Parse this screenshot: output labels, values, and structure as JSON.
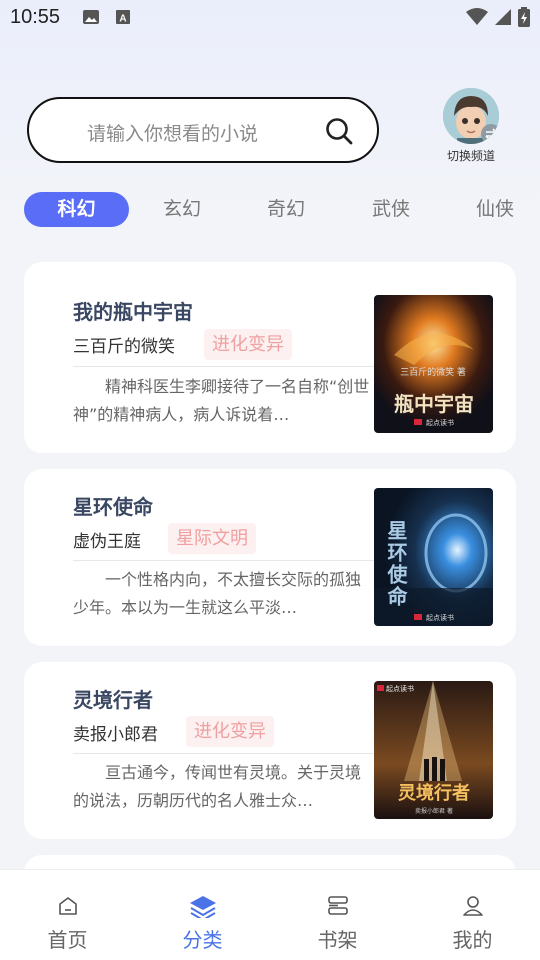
{
  "status_bar": {
    "time": "10:55"
  },
  "search": {
    "placeholder": "请输入你想看的小说"
  },
  "channel_switch": {
    "label": "切换频道"
  },
  "tabs": [
    {
      "label": "科幻",
      "active": true
    },
    {
      "label": "玄幻",
      "active": false
    },
    {
      "label": "奇幻",
      "active": false
    },
    {
      "label": "武侠",
      "active": false
    },
    {
      "label": "仙侠",
      "active": false
    }
  ],
  "books": [
    {
      "title": "我的瓶中宇宙",
      "author": "三百斤的微笑",
      "tag": "进化变异",
      "description": "精神科医生李卿接待了一名自称“创世神”的精神病人，病人诉说着…",
      "cover_title": "瓶中宇宙",
      "cover_top": "三百斤的微笑 著",
      "cover_badge": "起点读书"
    },
    {
      "title": "星环使命",
      "author": "虚伪王庭",
      "tag": "星际文明",
      "description": "一个性格内向，不太擅长交际的孤独少年。本以为一生就这么平淡…",
      "cover_title": "星环使命",
      "cover_badge": "起点读书"
    },
    {
      "title": "灵境行者",
      "author": "卖报小郎君",
      "tag": "进化变异",
      "description": "亘古通今，传闻世有灵境。关于灵境的说法，历朝历代的名人雅士众…",
      "cover_title": "灵境行者",
      "cover_top": "起点读书",
      "cover_bottom": "卖报小郎君 著"
    }
  ],
  "bottom_nav": [
    {
      "label": "首页",
      "active": false
    },
    {
      "label": "分类",
      "active": true
    },
    {
      "label": "书架",
      "active": false
    },
    {
      "label": "我的",
      "active": false
    }
  ],
  "colors": {
    "accent": "#5a6df7",
    "nav_active": "#4a73e8",
    "tag_text": "#f0a0a0",
    "tag_bg": "#fdf0f0"
  }
}
